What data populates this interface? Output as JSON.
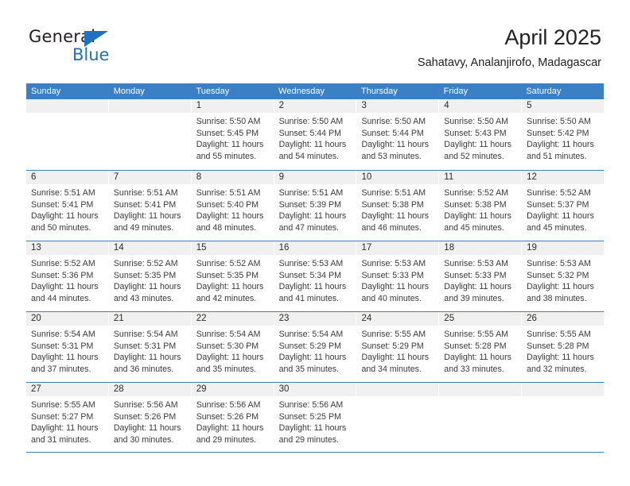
{
  "logo": {
    "word_one": "General",
    "word_two": "Blue",
    "triangle_icon": "triangle-icon",
    "accent_color": "#1f72bd"
  },
  "header": {
    "title": "April 2025",
    "subtitle": "Sahatavy, Analanjirofo, Madagascar"
  },
  "theme": {
    "header_blue": "#3b7fc4",
    "band_gray": "#f0f0f0",
    "text": "#222222"
  },
  "weekdays": [
    "Sunday",
    "Monday",
    "Tuesday",
    "Wednesday",
    "Thursday",
    "Friday",
    "Saturday"
  ],
  "weeks": [
    [
      {
        "date": "",
        "sunrise": "",
        "sunset": "",
        "daylight_line1": "",
        "daylight_line2": ""
      },
      {
        "date": "",
        "sunrise": "",
        "sunset": "",
        "daylight_line1": "",
        "daylight_line2": ""
      },
      {
        "date": "1",
        "sunrise": "Sunrise: 5:50 AM",
        "sunset": "Sunset: 5:45 PM",
        "daylight_line1": "Daylight: 11 hours",
        "daylight_line2": "and 55 minutes."
      },
      {
        "date": "2",
        "sunrise": "Sunrise: 5:50 AM",
        "sunset": "Sunset: 5:44 PM",
        "daylight_line1": "Daylight: 11 hours",
        "daylight_line2": "and 54 minutes."
      },
      {
        "date": "3",
        "sunrise": "Sunrise: 5:50 AM",
        "sunset": "Sunset: 5:44 PM",
        "daylight_line1": "Daylight: 11 hours",
        "daylight_line2": "and 53 minutes."
      },
      {
        "date": "4",
        "sunrise": "Sunrise: 5:50 AM",
        "sunset": "Sunset: 5:43 PM",
        "daylight_line1": "Daylight: 11 hours",
        "daylight_line2": "and 52 minutes."
      },
      {
        "date": "5",
        "sunrise": "Sunrise: 5:50 AM",
        "sunset": "Sunset: 5:42 PM",
        "daylight_line1": "Daylight: 11 hours",
        "daylight_line2": "and 51 minutes."
      }
    ],
    [
      {
        "date": "6",
        "sunrise": "Sunrise: 5:51 AM",
        "sunset": "Sunset: 5:41 PM",
        "daylight_line1": "Daylight: 11 hours",
        "daylight_line2": "and 50 minutes."
      },
      {
        "date": "7",
        "sunrise": "Sunrise: 5:51 AM",
        "sunset": "Sunset: 5:41 PM",
        "daylight_line1": "Daylight: 11 hours",
        "daylight_line2": "and 49 minutes."
      },
      {
        "date": "8",
        "sunrise": "Sunrise: 5:51 AM",
        "sunset": "Sunset: 5:40 PM",
        "daylight_line1": "Daylight: 11 hours",
        "daylight_line2": "and 48 minutes."
      },
      {
        "date": "9",
        "sunrise": "Sunrise: 5:51 AM",
        "sunset": "Sunset: 5:39 PM",
        "daylight_line1": "Daylight: 11 hours",
        "daylight_line2": "and 47 minutes."
      },
      {
        "date": "10",
        "sunrise": "Sunrise: 5:51 AM",
        "sunset": "Sunset: 5:38 PM",
        "daylight_line1": "Daylight: 11 hours",
        "daylight_line2": "and 46 minutes."
      },
      {
        "date": "11",
        "sunrise": "Sunrise: 5:52 AM",
        "sunset": "Sunset: 5:38 PM",
        "daylight_line1": "Daylight: 11 hours",
        "daylight_line2": "and 45 minutes."
      },
      {
        "date": "12",
        "sunrise": "Sunrise: 5:52 AM",
        "sunset": "Sunset: 5:37 PM",
        "daylight_line1": "Daylight: 11 hours",
        "daylight_line2": "and 45 minutes."
      }
    ],
    [
      {
        "date": "13",
        "sunrise": "Sunrise: 5:52 AM",
        "sunset": "Sunset: 5:36 PM",
        "daylight_line1": "Daylight: 11 hours",
        "daylight_line2": "and 44 minutes."
      },
      {
        "date": "14",
        "sunrise": "Sunrise: 5:52 AM",
        "sunset": "Sunset: 5:35 PM",
        "daylight_line1": "Daylight: 11 hours",
        "daylight_line2": "and 43 minutes."
      },
      {
        "date": "15",
        "sunrise": "Sunrise: 5:52 AM",
        "sunset": "Sunset: 5:35 PM",
        "daylight_line1": "Daylight: 11 hours",
        "daylight_line2": "and 42 minutes."
      },
      {
        "date": "16",
        "sunrise": "Sunrise: 5:53 AM",
        "sunset": "Sunset: 5:34 PM",
        "daylight_line1": "Daylight: 11 hours",
        "daylight_line2": "and 41 minutes."
      },
      {
        "date": "17",
        "sunrise": "Sunrise: 5:53 AM",
        "sunset": "Sunset: 5:33 PM",
        "daylight_line1": "Daylight: 11 hours",
        "daylight_line2": "and 40 minutes."
      },
      {
        "date": "18",
        "sunrise": "Sunrise: 5:53 AM",
        "sunset": "Sunset: 5:33 PM",
        "daylight_line1": "Daylight: 11 hours",
        "daylight_line2": "and 39 minutes."
      },
      {
        "date": "19",
        "sunrise": "Sunrise: 5:53 AM",
        "sunset": "Sunset: 5:32 PM",
        "daylight_line1": "Daylight: 11 hours",
        "daylight_line2": "and 38 minutes."
      }
    ],
    [
      {
        "date": "20",
        "sunrise": "Sunrise: 5:54 AM",
        "sunset": "Sunset: 5:31 PM",
        "daylight_line1": "Daylight: 11 hours",
        "daylight_line2": "and 37 minutes."
      },
      {
        "date": "21",
        "sunrise": "Sunrise: 5:54 AM",
        "sunset": "Sunset: 5:31 PM",
        "daylight_line1": "Daylight: 11 hours",
        "daylight_line2": "and 36 minutes."
      },
      {
        "date": "22",
        "sunrise": "Sunrise: 5:54 AM",
        "sunset": "Sunset: 5:30 PM",
        "daylight_line1": "Daylight: 11 hours",
        "daylight_line2": "and 35 minutes."
      },
      {
        "date": "23",
        "sunrise": "Sunrise: 5:54 AM",
        "sunset": "Sunset: 5:29 PM",
        "daylight_line1": "Daylight: 11 hours",
        "daylight_line2": "and 35 minutes."
      },
      {
        "date": "24",
        "sunrise": "Sunrise: 5:55 AM",
        "sunset": "Sunset: 5:29 PM",
        "daylight_line1": "Daylight: 11 hours",
        "daylight_line2": "and 34 minutes."
      },
      {
        "date": "25",
        "sunrise": "Sunrise: 5:55 AM",
        "sunset": "Sunset: 5:28 PM",
        "daylight_line1": "Daylight: 11 hours",
        "daylight_line2": "and 33 minutes."
      },
      {
        "date": "26",
        "sunrise": "Sunrise: 5:55 AM",
        "sunset": "Sunset: 5:28 PM",
        "daylight_line1": "Daylight: 11 hours",
        "daylight_line2": "and 32 minutes."
      }
    ],
    [
      {
        "date": "27",
        "sunrise": "Sunrise: 5:55 AM",
        "sunset": "Sunset: 5:27 PM",
        "daylight_line1": "Daylight: 11 hours",
        "daylight_line2": "and 31 minutes."
      },
      {
        "date": "28",
        "sunrise": "Sunrise: 5:56 AM",
        "sunset": "Sunset: 5:26 PM",
        "daylight_line1": "Daylight: 11 hours",
        "daylight_line2": "and 30 minutes."
      },
      {
        "date": "29",
        "sunrise": "Sunrise: 5:56 AM",
        "sunset": "Sunset: 5:26 PM",
        "daylight_line1": "Daylight: 11 hours",
        "daylight_line2": "and 29 minutes."
      },
      {
        "date": "30",
        "sunrise": "Sunrise: 5:56 AM",
        "sunset": "Sunset: 5:25 PM",
        "daylight_line1": "Daylight: 11 hours",
        "daylight_line2": "and 29 minutes."
      },
      {
        "date": "",
        "sunrise": "",
        "sunset": "",
        "daylight_line1": "",
        "daylight_line2": ""
      },
      {
        "date": "",
        "sunrise": "",
        "sunset": "",
        "daylight_line1": "",
        "daylight_line2": ""
      },
      {
        "date": "",
        "sunrise": "",
        "sunset": "",
        "daylight_line1": "",
        "daylight_line2": ""
      }
    ]
  ]
}
